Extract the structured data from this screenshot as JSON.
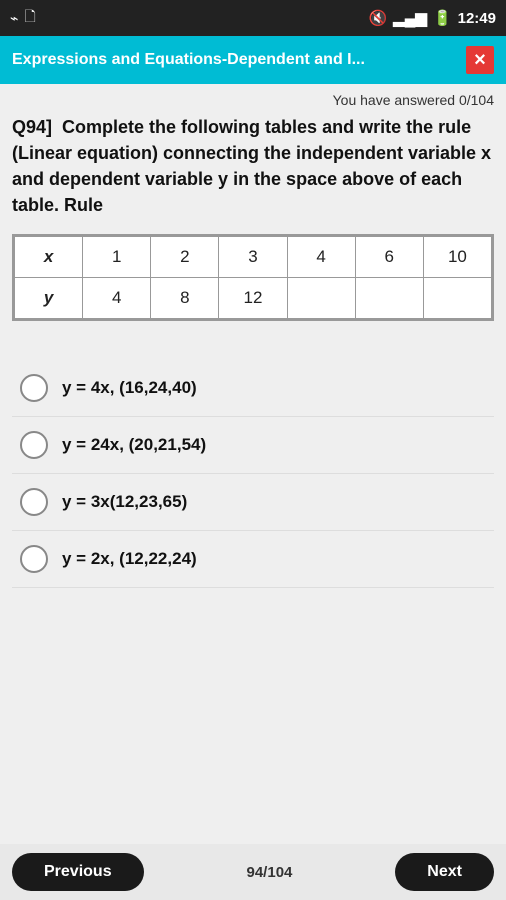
{
  "status_bar": {
    "time": "12:49",
    "icons_left": [
      "usb-icon",
      "file-icon"
    ]
  },
  "header": {
    "title": "Expressions and Equations-Dependent and I...",
    "close_label": "×"
  },
  "progress": {
    "text": "You have answered 0/104"
  },
  "question": {
    "number": "Q94]",
    "text": "Complete the following tables and write the rule (Linear equation) connecting the  independent variable x and dependent variable y in the space above of each table. Rule"
  },
  "table": {
    "headers": [
      "x",
      "1",
      "2",
      "3",
      "4",
      "6",
      "10"
    ],
    "row_label": "y",
    "row_values": [
      "4",
      "8",
      "12",
      "",
      "",
      ""
    ]
  },
  "options": [
    {
      "id": "a",
      "label": "y = 4x, (16,24,40)"
    },
    {
      "id": "b",
      "label": "y = 24x, (20,21,54)"
    },
    {
      "id": "c",
      "label": "y = 3x(12,23,65)"
    },
    {
      "id": "d",
      "label": "y = 2x, (12,22,24)"
    }
  ],
  "bottom_bar": {
    "previous_label": "Previous",
    "page_indicator": "94/104",
    "next_label": "Next"
  }
}
